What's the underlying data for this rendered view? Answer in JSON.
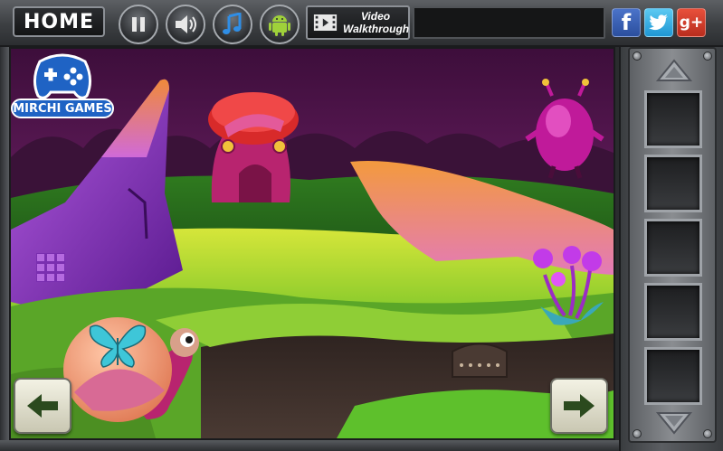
{
  "top_bar": {
    "home_label": "HOME",
    "pause_icon": "pause-icon",
    "sound_icon": "speaker-icon",
    "music_icon": "music-note-icon",
    "android_icon": "android-icon",
    "video_line1": "Video",
    "video_line2": "Walkthrough",
    "social": {
      "facebook_label": "f",
      "twitter_label": "t",
      "googleplus_label": "g+"
    }
  },
  "logo": {
    "brand_text": "MIRCHI GAMES",
    "icon": "gamepad-icon"
  },
  "scene": {
    "keypad_icon": "3x3-grid-panel",
    "door_icon": "arched-door",
    "butterfly_icon": "butterfly-icon"
  },
  "navigation": {
    "left_icon": "arrow-left-icon",
    "right_icon": "arrow-right-icon"
  },
  "inventory": {
    "up_icon": "arrow-up-icon",
    "down_icon": "arrow-down-icon",
    "slots": [
      "",
      "",
      "",
      "",
      ""
    ]
  },
  "colors": {
    "sky": "#5a1a55",
    "grass": "#6fbf2a",
    "rock_purple": "#8a35c8",
    "creature_magenta": "#c01a9a",
    "frame": "#4a4d51"
  }
}
